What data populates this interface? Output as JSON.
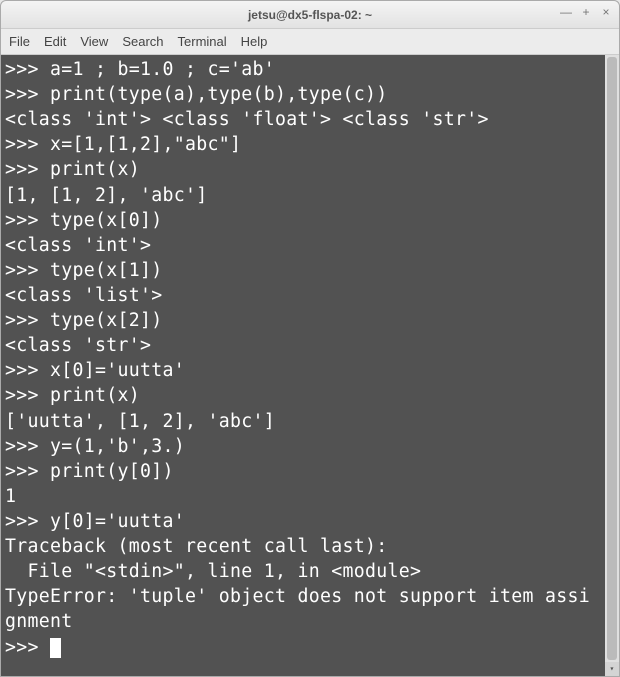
{
  "window": {
    "title": "jetsu@dx5-flspa-02: ~"
  },
  "menu": {
    "file": "File",
    "edit": "Edit",
    "view": "View",
    "search": "Search",
    "terminal": "Terminal",
    "help": "Help"
  },
  "terminal": {
    "content": ">>> a=1 ; b=1.0 ; c='ab'\n>>> print(type(a),type(b),type(c))\n<class 'int'> <class 'float'> <class 'str'>\n>>> x=[1,[1,2],\"abc\"]\n>>> print(x)\n[1, [1, 2], 'abc']\n>>> type(x[0])\n<class 'int'>\n>>> type(x[1])\n<class 'list'>\n>>> type(x[2])\n<class 'str'>\n>>> x[0]='uutta'\n>>> print(x)\n['uutta', [1, 2], 'abc']\n>>> y=(1,'b',3.)\n>>> print(y[0])\n1\n>>> y[0]='uutta'\nTraceback (most recent call last):\n  File \"<stdin>\", line 1, in <module>\nTypeError: 'tuple' object does not support item assignment\n>>> "
  }
}
